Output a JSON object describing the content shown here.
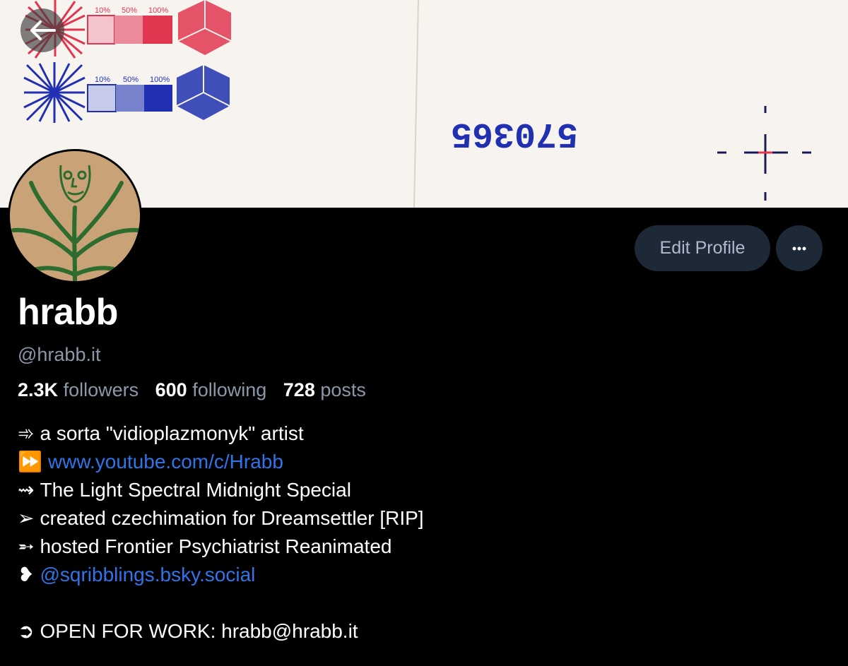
{
  "banner": {
    "swatch_labels_top": [
      "10%",
      "50%",
      "100%"
    ],
    "swatch_labels_bottom": [
      "10%",
      "50%",
      "100%"
    ],
    "stamp_number": "570365",
    "colors": {
      "red": "#e0364f",
      "blue": "#2030b0",
      "paper": "#f7f4ef"
    }
  },
  "back_button": {
    "icon": "arrow-left-icon"
  },
  "actions": {
    "edit_profile_label": "Edit Profile",
    "more_icon": "ellipsis-icon"
  },
  "profile": {
    "display_name": "hrabb",
    "handle": "@hrabb.it",
    "stats": {
      "followers_count": "2.3K",
      "followers_label": "followers",
      "following_count": "600",
      "following_label": "following",
      "posts_count": "728",
      "posts_label": "posts"
    },
    "bio": {
      "line1_glyph": "➾",
      "line1_text": "a sorta \"vidioplazmonyk\" artist",
      "line2_glyph": "⏩",
      "line2_link": "www.youtube.com/c/Hrabb",
      "line3_glyph": "⇝",
      "line3_text": "The Light Spectral Midnight Special",
      "line4_glyph": "➢",
      "line4_text": "created czechimation for Dreamsettler [RIP]",
      "line5_glyph": "➵",
      "line5_text": "hosted Frontier Psychiatrist Reanimated",
      "line6_glyph": "❥",
      "line6_link": "@sqribblings.bsky.social",
      "line7_glyph": "➲",
      "line7_text": "OPEN FOR WORK: hrabb@hrabb.it"
    }
  },
  "theme": {
    "bg": "#000000",
    "button_bg": "#1e2937",
    "muted": "#8b98a8",
    "link": "#2f74e8"
  }
}
